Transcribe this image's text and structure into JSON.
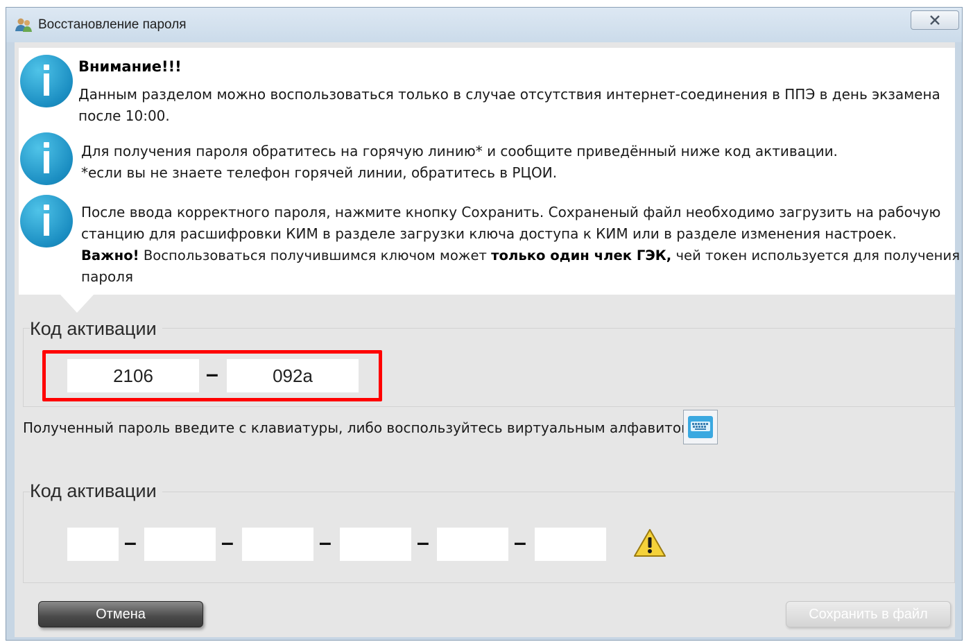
{
  "window": {
    "title": "Восстановление пароля",
    "close_label": "x"
  },
  "info": {
    "heading": "Внимание!!!",
    "block1_line1": "Данным разделом можно воспользоваться только в случае отсутствия интернет-соединения в ППЭ в день экзамена",
    "block1_line2": "после 10:00.",
    "block2_line1": "Для получения пароля обратитесь на горячую линию* и сообщите приведённый ниже код активации.",
    "block2_line2": "*если вы не знаете телефон горячей линии, обратитесь в РЦОИ.",
    "block3_line1": "После ввода корректного пароля, нажмите кнопку Сохранить. Сохраненый файл необходимо загрузить на рабочую",
    "block3_line2": "станцию для расшифровки КИМ в разделе загрузки ключа доступа к КИМ или в разделе изменения настроек.",
    "block3_important": "Важно!",
    "block3_mid": " Воспользоваться получившимся ключом может ",
    "block3_bold": "только один члек ГЭК,",
    "block3_end": " чей токен используется для получения",
    "block3_line4": "пароля"
  },
  "activation": {
    "label": "Код активации",
    "part1": "2106",
    "separator": "–",
    "part2": "092a"
  },
  "hint": "Полученный пароль введите с клавиатуры, либо воспользуйтесь виртуальным алфавитом.",
  "password": {
    "label": "Код активации",
    "fields": [
      "",
      "",
      "",
      "",
      "",
      ""
    ],
    "separator": "–"
  },
  "buttons": {
    "cancel": "Отмена",
    "save": "Сохранить в файл"
  },
  "colors": {
    "highlight": "#ff0000",
    "info_blue": "#1b8ec2",
    "warning": "#f5d23a"
  }
}
